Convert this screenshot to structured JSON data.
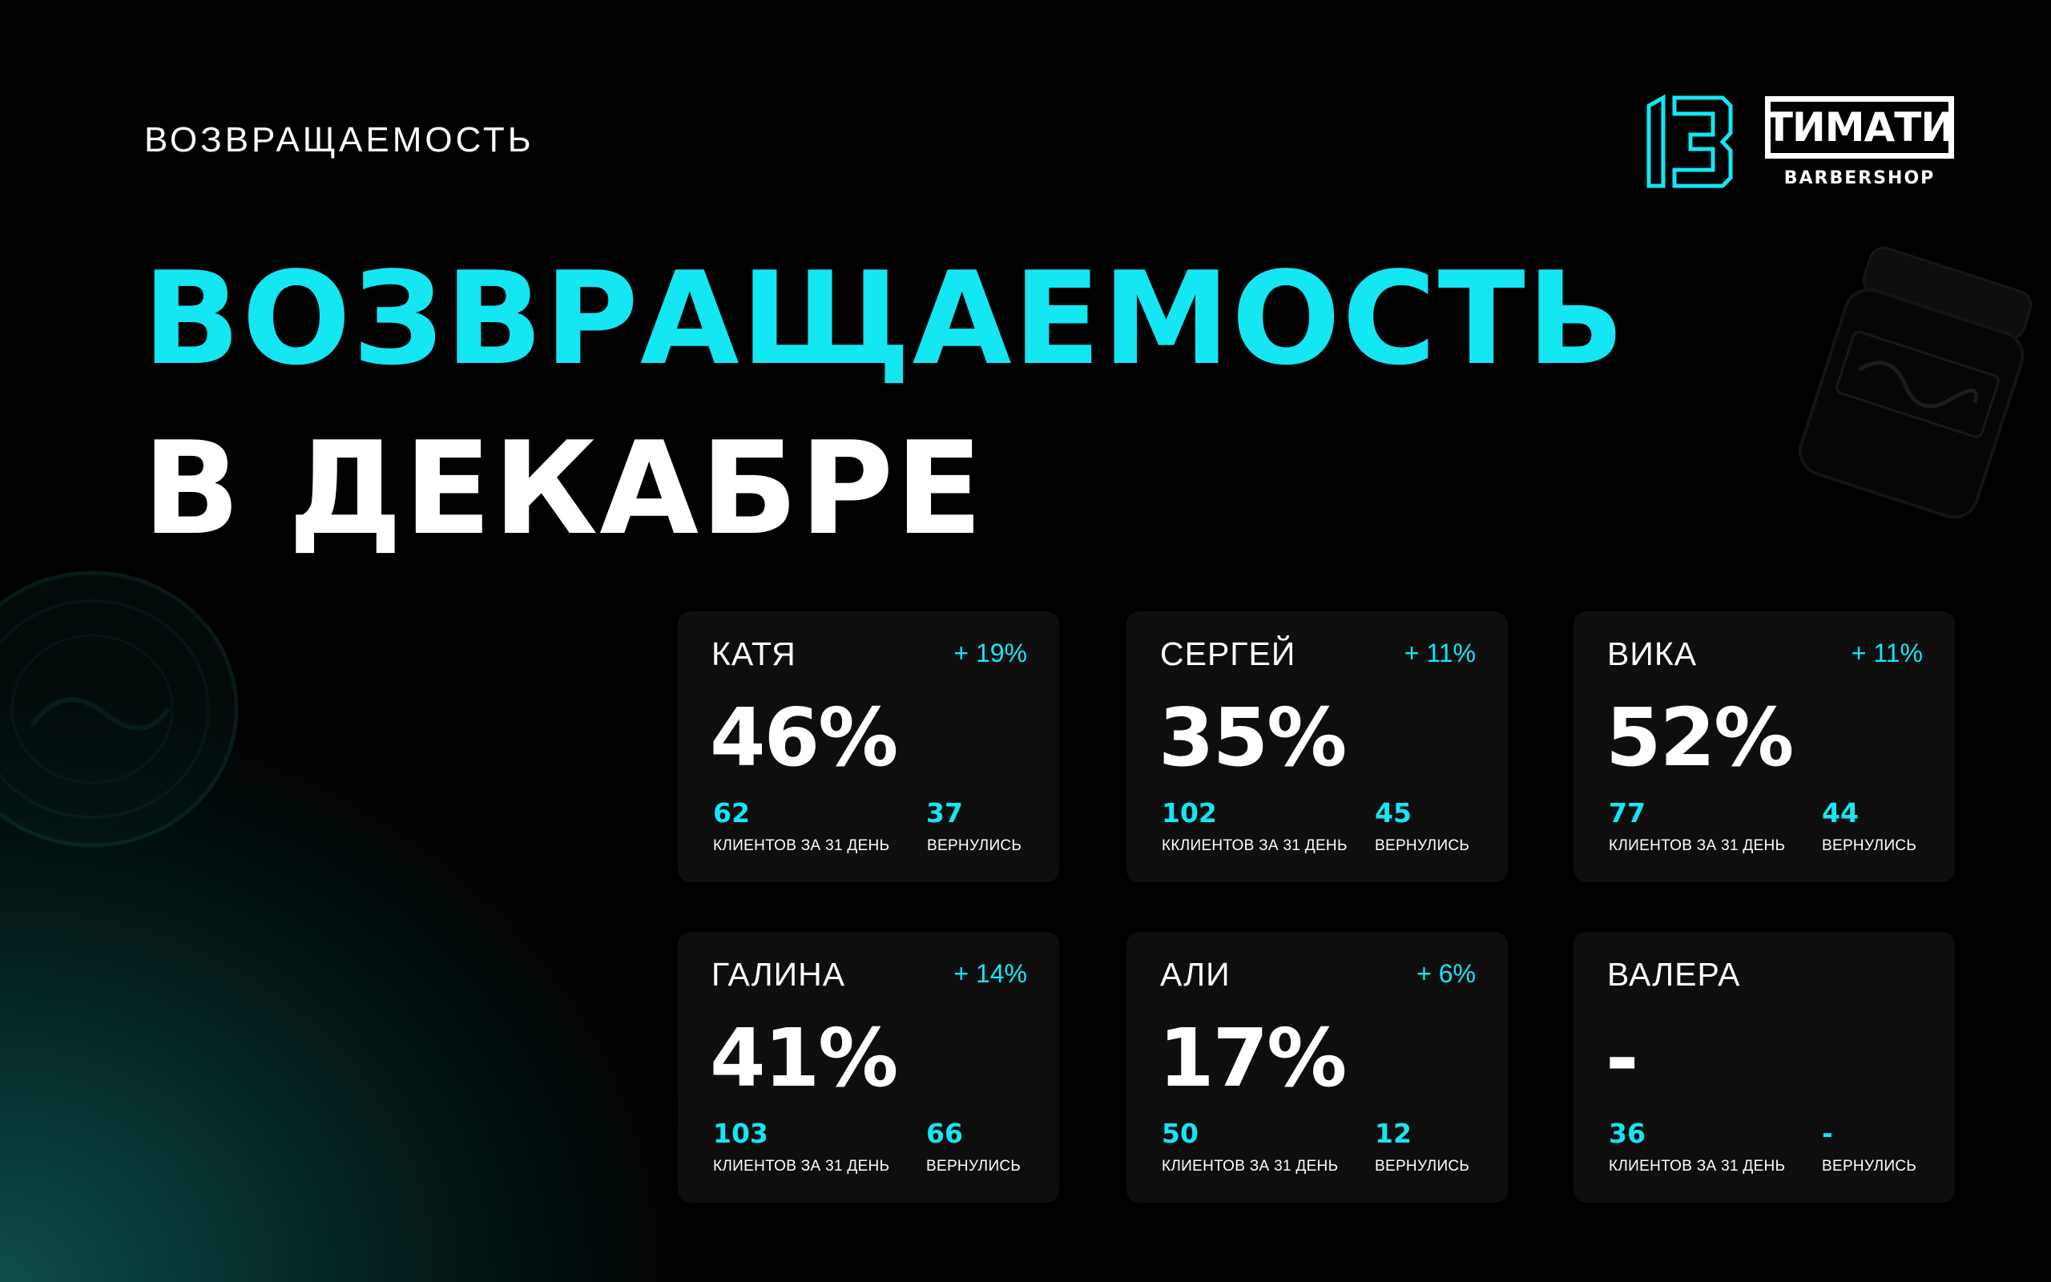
{
  "header": {
    "eyebrow": "ВОЗВРАЩАЕМОСТЬ",
    "headline_line1": "ВОЗВРАЩАЕМОСТЬ",
    "headline_line2": "В ДЕКАБРЕ"
  },
  "logo": {
    "number": "13",
    "brand": "ТИМАТИ",
    "sub": "BARBERSHOP"
  },
  "colors": {
    "accent": "#14e6f2",
    "background": "#000000",
    "card": "#0e0e0f",
    "text": "#ffffff"
  },
  "cards": [
    {
      "name": "КАТЯ",
      "delta": "+ 19%",
      "percent": "46%",
      "clients": "62",
      "clients_label": "КЛИЕНТОВ ЗА 31 ДЕНЬ",
      "returned": "37",
      "returned_label": "ВЕРНУЛИСЬ"
    },
    {
      "name": "СЕРГЕЙ",
      "delta": "+ 11%",
      "percent": "35%",
      "clients": "102",
      "clients_label": "ККЛИЕНТОВ ЗА 31 ДЕНЬ",
      "returned": "45",
      "returned_label": "ВЕРНУЛИСЬ"
    },
    {
      "name": "ВИКА",
      "delta": "+ 11%",
      "percent": "52%",
      "clients": "77",
      "clients_label": "КЛИЕНТОВ ЗА 31 ДЕНЬ",
      "returned": "44",
      "returned_label": "ВЕРНУЛИСЬ"
    },
    {
      "name": "ГАЛИНА",
      "delta": "+ 14%",
      "percent": "41%",
      "clients": "103",
      "clients_label": "КЛИЕНТОВ ЗА 31 ДЕНЬ",
      "returned": "66",
      "returned_label": "ВЕРНУЛИСЬ"
    },
    {
      "name": "АЛИ",
      "delta": "+ 6%",
      "percent": "17%",
      "clients": "50",
      "clients_label": "КЛИЕНТОВ ЗА 31 ДЕНЬ",
      "returned": "12",
      "returned_label": "ВЕРНУЛИСЬ"
    },
    {
      "name": "ВАЛЕРА",
      "delta": "",
      "percent": "-",
      "clients": "36",
      "clients_label": "КЛИЕНТОВ ЗА 31 ДЕНЬ",
      "returned": "-",
      "returned_label": "ВЕРНУЛИСЬ"
    }
  ]
}
